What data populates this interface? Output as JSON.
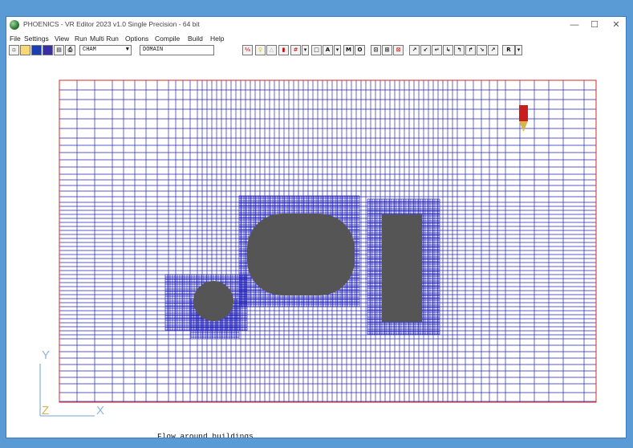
{
  "window": {
    "title": "PHOENICS - VR Editor 2023 v1.0 Single Precision - 64 bit",
    "controls": [
      "—",
      "☐",
      "✕"
    ]
  },
  "menu": [
    "File",
    "Settings",
    "View",
    "Run",
    "Multi Run",
    "Options",
    "Compile",
    "Build",
    "Help"
  ],
  "toolbar": {
    "combo_value": "CHAM",
    "field_value": "DOMAIN",
    "text_buttons": {
      "m": "M",
      "o": "O",
      "r": "R"
    }
  },
  "viewport": {
    "caption": "Flow around buildings",
    "axes": {
      "y": "Y",
      "z": "Z",
      "x": "X"
    }
  },
  "colors": {
    "grid": "#2323b8",
    "domain_border": "#d42a2a",
    "obstacle": "#555555",
    "axis_y": "#8fb6e0",
    "axis_z": "#d9b25a",
    "axis_x": "#8fb6e0",
    "probe": "#c81e1e"
  }
}
